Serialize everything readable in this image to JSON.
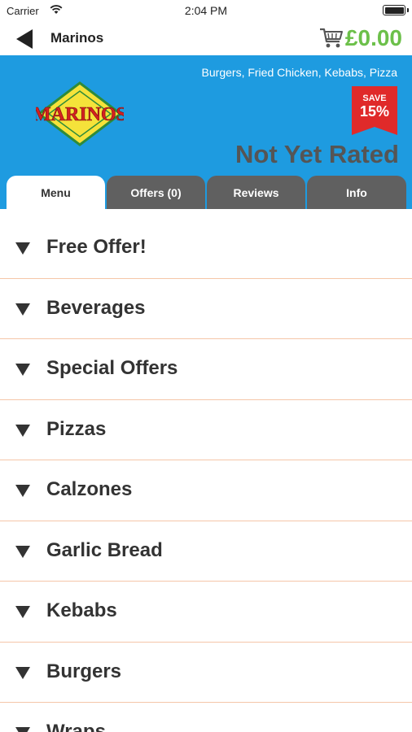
{
  "status_bar": {
    "carrier": "Carrier",
    "time": "2:04 PM"
  },
  "nav": {
    "title": "Marinos",
    "cart_total": "£0.00"
  },
  "restaurant": {
    "cuisines": "Burgers, Fried Chicken, Kebabs, Pizza",
    "logo_text": "MARINOS",
    "save_label": "SAVE",
    "save_percent": "15%",
    "rating": "Not Yet Rated"
  },
  "tabs": [
    {
      "label": "Menu",
      "active": true
    },
    {
      "label": "Offers (0)",
      "active": false
    },
    {
      "label": "Reviews",
      "active": false
    },
    {
      "label": "Info",
      "active": false
    }
  ],
  "menu_categories": [
    "Free Offer!",
    "Beverages",
    "Special Offers",
    "Pizzas",
    "Calzones",
    "Garlic Bread",
    "Kebabs",
    "Burgers",
    "Wraps"
  ],
  "colors": {
    "banner": "#1e9be0",
    "cart_total": "#6cc04a",
    "save_badge": "#e02a2a",
    "tab_inactive": "#606060",
    "divider": "#f5c6a8"
  }
}
